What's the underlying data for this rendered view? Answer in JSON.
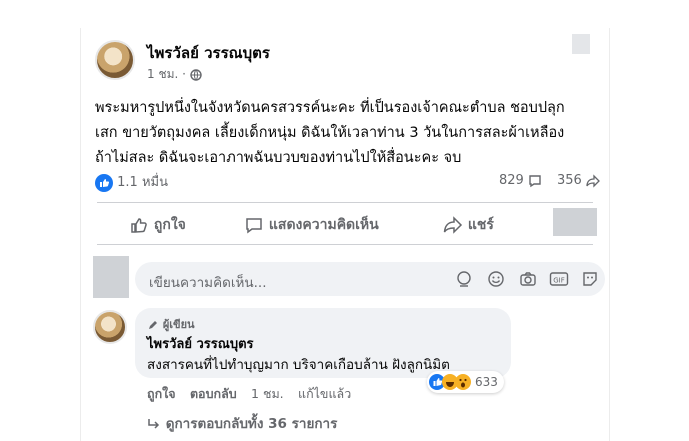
{
  "post": {
    "author": "ไพรวัลย์ วรรณบุตร",
    "time": "1 ชม.",
    "text_lines": [
      "พระมหารูปหนึ่งในจังหวัดนครสวรรค์นะคะ ที่เป็นรองเจ้าคณะตำบล ชอบปลุก",
      "เสก ขายวัตถุมงคล เลี้ยงเด็กหนุ่ม ดิฉันให้เวลาท่าน 3 วันในการสละผ้าเหลือง",
      "ถ้าไม่สละ ดิฉันจะเอาภาพฉันบวบของท่านไปให้สื่อนะคะ จบ"
    ],
    "reaction_count": "1.1 หมื่น",
    "comment_count": "829",
    "share_count": "356"
  },
  "actions": {
    "like": "ถูกใจ",
    "comment": "แสดงความคิดเห็น",
    "share": "แชร์"
  },
  "composer": {
    "placeholder": "เขียนความคิดเห็น..."
  },
  "comment": {
    "badge": "ผู้เขียน",
    "author": "ไพรวัลย์ วรรณบุตร",
    "text": "สงสารคนที่ไปทำบุญมาก บริจาคเกือบล้าน ฝังลูกนิมิต",
    "reaction_count": "633",
    "like": "ถูกใจ",
    "reply": "ตอบกลับ",
    "time": "1 ชม.",
    "edited": "แก้ไขแล้ว"
  },
  "replies_link": "ดูการตอบกลับทั้ง 36 รายการ",
  "colors": {
    "like_blue": "#1877f2",
    "muted": "#65676b",
    "bubble": "#f0f2f5"
  }
}
